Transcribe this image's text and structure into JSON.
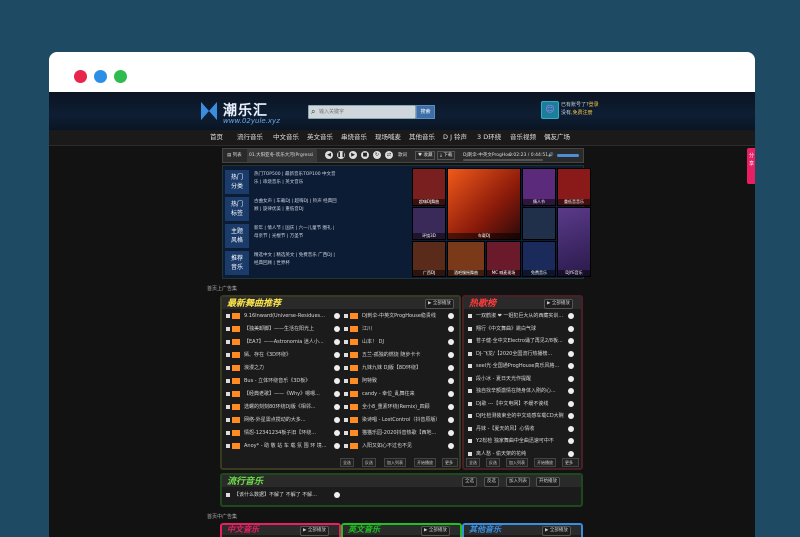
{
  "window": {
    "dots": [
      "#e8254a",
      "#2d8ee6",
      "#2fbb4f"
    ]
  },
  "header": {
    "logo_text": "潮乐汇",
    "logo_url": "www.02yule.xyz",
    "search_placeholder": "输入关键字",
    "search_button": "搜索",
    "user_line1": "已有账号了?",
    "user_login": "登录",
    "user_line2": "没有,",
    "user_register": "免费注册"
  },
  "nav": [
    "首页",
    "流行音乐",
    "中文音乐",
    "英文音乐",
    "串烧音乐",
    "现场喊麦",
    "其他音乐",
    "D J 铃声",
    "3 D环绕",
    "音乐视频",
    "偶友广场"
  ],
  "player": {
    "list_label": "列表",
    "current": "01.大阳亚冬-欢乐大河(Prgressi",
    "lyric_label": "歌词",
    "favorite_label": "收藏",
    "download_label": "下载",
    "track": "DJ刺伞-中英文ProgHouse稳贵线...",
    "time": "0:02:23 / 0:44:51"
  },
  "categories": [
    {
      "name1": "热门",
      "name2": "分类",
      "tags": "热门TOP500 | 最新音乐TOP100 中文音乐 | 串烧音乐 | 英文音乐"
    },
    {
      "name1": "热门",
      "name2": "标签",
      "tags": "古曲女声 | 车载DJ | 超嗨DJ | 铃声 经典回顾 | 旋律优美 | 重低音DJ"
    },
    {
      "name1": "主题",
      "name2": "风格",
      "tags": "新年 | 情人节 | 国庆 | 六一儿童节 圈礼 | 母亲节 | 光棍节 | 万圣节"
    },
    {
      "name1": "推荐",
      "name2": "音乐",
      "tags": "精选中文 | 精选英文 | 免费音乐 广西DJ | 经典回顾 | 世界杯"
    }
  ],
  "tiles": [
    {
      "label": "超嗨DJ舞曲",
      "color": "#7a1f1f"
    },
    {
      "label": "车载DJ",
      "color": "#b8431a"
    },
    {
      "label": "情人节",
      "color": "#5b2a7a"
    },
    {
      "label": "重低音音乐",
      "color": "#8a1a1a"
    },
    {
      "label": "环绕3D",
      "color": "#3a2a5a"
    },
    {
      "label": "",
      "color": "#20304a"
    },
    {
      "label": "广西DJ",
      "color": "#5a2a1a"
    },
    {
      "label": "酒吧慢摇舞曲",
      "color": "#7a3a1a"
    },
    {
      "label": "MC 喊麦现场",
      "color": "#6a1a2a"
    },
    {
      "label": "免费音乐",
      "color": "#1a2a5a"
    },
    {
      "label": "DJYE音乐",
      "color": "#2a1a4a"
    }
  ],
  "ad_top": "首页上广告集",
  "latest": {
    "title": "最新舞曲推荐",
    "play_all": "全部播放",
    "left": [
      {
        "n": "",
        "t": "9.16Inward(Universe-Residues..."
      },
      {
        "n": "",
        "t": "【独美卸脚】——生活在阳光上"
      },
      {
        "n": "",
        "t": "【EA7】——Astronomia 迷人小..."
      },
      {
        "n": "",
        "t": "嫣、存在《3D环绕》"
      },
      {
        "n": "",
        "t": "浪漫之力"
      },
      {
        "n": "",
        "t": "Bus - 立体环绕音乐《3D板》"
      },
      {
        "n": "",
        "t": "【经典老歌】——《Why》嗯嗯..."
      },
      {
        "n": "",
        "t": "选螺的刻刻80环绕DJ版《相邻..."
      },
      {
        "n": "",
        "t": "网络-外星需点搅动的大多..."
      },
      {
        "n": "",
        "t": "情怨-12341234板子旧【环绕..."
      },
      {
        "n": "",
        "t": "Anoy* - 助 敬 站 车 载 氛 围 环 境..."
      }
    ],
    "right": [
      {
        "t": "DJ刺伞-中英文ProgHouse稳贵线"
      },
      {
        "t": "江川"
      },
      {
        "t": "山本！ DJ"
      },
      {
        "t": "五兰-孤独的燃烧 随步卡卡"
      },
      {
        "t": "九妹九妹 DJ版【8D环绕】"
      },
      {
        "t": "阿特致"
      },
      {
        "t": "candy - 幸位_乱舞往来"
      },
      {
        "t": "全小8_重素环绕(Remix)_四顾"
      },
      {
        "t": "染诗唱 - LostControl（抖音原版）"
      },
      {
        "t": "猫猫乐园-2020抖音热歌【西地..."
      },
      {
        "t": "入阳又如心不过也不见"
      }
    ],
    "foot": [
      "全选",
      "反选",
      "加入列表",
      "开始播放",
      "更多>"
    ]
  },
  "hot": {
    "title": "热歌榜",
    "play_all": "全部播放",
    "items": [
      "一双鹤淑 ❤ 一姐犯巨大从的西藏实训...",
      "翔行《中文舞曲》跳白气球",
      "苍子健·全中文Electro诵了再见2/8板...",
      "DJ-飞龙/【2020全国流行热播榜...",
      "seel光·全国通ProgHouse真乐风格...",
      "段小冰 - 夏日天光作提醒",
      "独自找辛额激情在随身体入刚的心...",
      "DJ歌 ---【中文电网】不缓不诶线",
      "DJ吐检测装束全的中文动感车载CD大碗...",
      "丹妹 -【夏天的风】心情收",
      "Y2松检 独家舞曲中全曲迅速可中不",
      "离人愁 - 偷天架的花纯"
    ],
    "foot": [
      "全选",
      "反选",
      "加入列表",
      "开始播放",
      "更多>"
    ]
  },
  "pop": {
    "title": "流行音乐",
    "pills": [
      "全选",
      "反选",
      "加入列表",
      "开始播放",
      "更多>"
    ],
    "item": "【该什么数据】不解了 不解了 不解..."
  },
  "ad_mid": "首页中广告集",
  "bottom_boxes": [
    {
      "title": "中文音乐",
      "play_all": "全部播放",
      "color": "#e91e63"
    },
    {
      "title": "英文音乐",
      "play_all": "全部播放",
      "color": "#20c020"
    },
    {
      "title": "其他音乐",
      "play_all": "全部播放",
      "color": "#3a8ee0"
    }
  ],
  "share": "分享"
}
